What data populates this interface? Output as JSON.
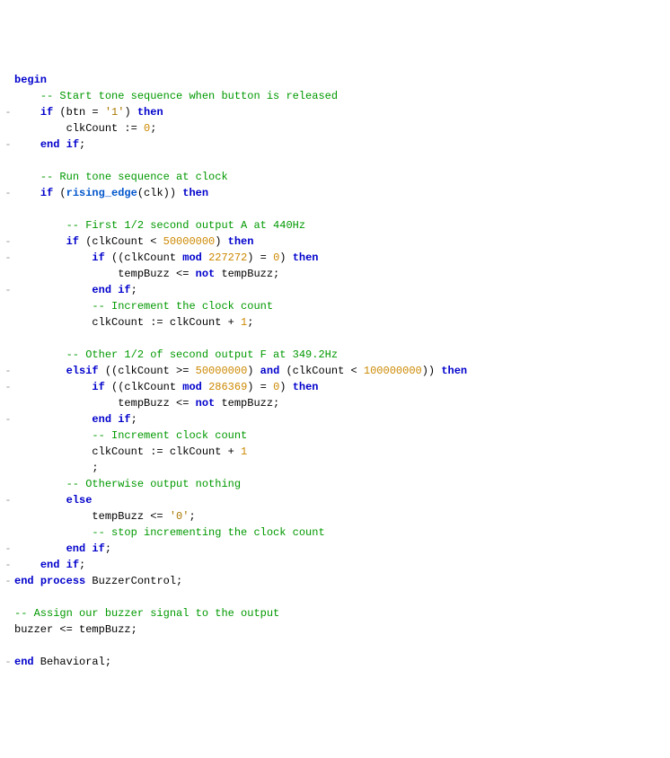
{
  "code": {
    "lines": [
      {
        "fold": " ",
        "segs": [
          {
            "cls": "kw",
            "t": "begin"
          }
        ]
      },
      {
        "fold": " ",
        "segs": [
          {
            "cls": "",
            "t": "    "
          },
          {
            "cls": "cmt",
            "t": "-- Start tone sequence when button is released"
          }
        ]
      },
      {
        "fold": "-",
        "segs": [
          {
            "cls": "",
            "t": "    "
          },
          {
            "cls": "kw",
            "t": "if"
          },
          {
            "cls": "",
            "t": " (btn = "
          },
          {
            "cls": "str",
            "t": "'1'"
          },
          {
            "cls": "",
            "t": ") "
          },
          {
            "cls": "kw",
            "t": "then"
          }
        ]
      },
      {
        "fold": " ",
        "segs": [
          {
            "cls": "",
            "t": "        clkCount := "
          },
          {
            "cls": "num",
            "t": "0"
          },
          {
            "cls": "",
            "t": ";"
          }
        ]
      },
      {
        "fold": "-",
        "segs": [
          {
            "cls": "",
            "t": "    "
          },
          {
            "cls": "kw",
            "t": "end"
          },
          {
            "cls": "",
            "t": " "
          },
          {
            "cls": "kw",
            "t": "if"
          },
          {
            "cls": "",
            "t": ";"
          }
        ]
      },
      {
        "fold": " ",
        "segs": [
          {
            "cls": "",
            "t": ""
          }
        ]
      },
      {
        "fold": " ",
        "segs": [
          {
            "cls": "",
            "t": "    "
          },
          {
            "cls": "cmt",
            "t": "-- Run tone sequence at clock"
          }
        ]
      },
      {
        "fold": "-",
        "segs": [
          {
            "cls": "",
            "t": "    "
          },
          {
            "cls": "kw",
            "t": "if"
          },
          {
            "cls": "",
            "t": " ("
          },
          {
            "cls": "func",
            "t": "rising_edge"
          },
          {
            "cls": "",
            "t": "(clk)) "
          },
          {
            "cls": "kw",
            "t": "then"
          }
        ]
      },
      {
        "fold": " ",
        "segs": [
          {
            "cls": "",
            "t": ""
          }
        ]
      },
      {
        "fold": " ",
        "segs": [
          {
            "cls": "",
            "t": "        "
          },
          {
            "cls": "cmt",
            "t": "-- First 1/2 second output A at 440Hz"
          }
        ]
      },
      {
        "fold": "-",
        "segs": [
          {
            "cls": "",
            "t": "        "
          },
          {
            "cls": "kw",
            "t": "if"
          },
          {
            "cls": "",
            "t": " (clkCount < "
          },
          {
            "cls": "num",
            "t": "50000000"
          },
          {
            "cls": "",
            "t": ") "
          },
          {
            "cls": "kw",
            "t": "then"
          }
        ]
      },
      {
        "fold": "-",
        "segs": [
          {
            "cls": "",
            "t": "            "
          },
          {
            "cls": "kw",
            "t": "if"
          },
          {
            "cls": "",
            "t": " ((clkCount "
          },
          {
            "cls": "kw",
            "t": "mod"
          },
          {
            "cls": "",
            "t": " "
          },
          {
            "cls": "num",
            "t": "227272"
          },
          {
            "cls": "",
            "t": ") = "
          },
          {
            "cls": "num",
            "t": "0"
          },
          {
            "cls": "",
            "t": ") "
          },
          {
            "cls": "kw",
            "t": "then"
          }
        ]
      },
      {
        "fold": " ",
        "segs": [
          {
            "cls": "",
            "t": "                tempBuzz <= "
          },
          {
            "cls": "kw",
            "t": "not"
          },
          {
            "cls": "",
            "t": " tempBuzz;"
          }
        ]
      },
      {
        "fold": "-",
        "segs": [
          {
            "cls": "",
            "t": "            "
          },
          {
            "cls": "kw",
            "t": "end"
          },
          {
            "cls": "",
            "t": " "
          },
          {
            "cls": "kw",
            "t": "if"
          },
          {
            "cls": "",
            "t": ";"
          }
        ]
      },
      {
        "fold": " ",
        "segs": [
          {
            "cls": "",
            "t": "            "
          },
          {
            "cls": "cmt",
            "t": "-- Increment the clock count"
          }
        ]
      },
      {
        "fold": " ",
        "segs": [
          {
            "cls": "",
            "t": "            clkCount := clkCount + "
          },
          {
            "cls": "num",
            "t": "1"
          },
          {
            "cls": "",
            "t": ";"
          }
        ]
      },
      {
        "fold": " ",
        "segs": [
          {
            "cls": "",
            "t": ""
          }
        ]
      },
      {
        "fold": " ",
        "segs": [
          {
            "cls": "",
            "t": "        "
          },
          {
            "cls": "cmt",
            "t": "-- Other 1/2 of second output F at 349.2Hz"
          }
        ]
      },
      {
        "fold": "-",
        "segs": [
          {
            "cls": "",
            "t": "        "
          },
          {
            "cls": "kw",
            "t": "elsif"
          },
          {
            "cls": "",
            "t": " ((clkCount >= "
          },
          {
            "cls": "num",
            "t": "50000000"
          },
          {
            "cls": "",
            "t": ") "
          },
          {
            "cls": "kw",
            "t": "and"
          },
          {
            "cls": "",
            "t": " (clkCount < "
          },
          {
            "cls": "num",
            "t": "100000000"
          },
          {
            "cls": "",
            "t": ")) "
          },
          {
            "cls": "kw",
            "t": "then"
          }
        ]
      },
      {
        "fold": "-",
        "segs": [
          {
            "cls": "",
            "t": "            "
          },
          {
            "cls": "kw",
            "t": "if"
          },
          {
            "cls": "",
            "t": " ((clkCount "
          },
          {
            "cls": "kw",
            "t": "mod"
          },
          {
            "cls": "",
            "t": " "
          },
          {
            "cls": "num",
            "t": "286369"
          },
          {
            "cls": "",
            "t": ") = "
          },
          {
            "cls": "num",
            "t": "0"
          },
          {
            "cls": "",
            "t": ") "
          },
          {
            "cls": "kw",
            "t": "then"
          }
        ]
      },
      {
        "fold": " ",
        "segs": [
          {
            "cls": "",
            "t": "                tempBuzz <= "
          },
          {
            "cls": "kw",
            "t": "not"
          },
          {
            "cls": "",
            "t": " tempBuzz;"
          }
        ]
      },
      {
        "fold": "-",
        "segs": [
          {
            "cls": "",
            "t": "            "
          },
          {
            "cls": "kw",
            "t": "end"
          },
          {
            "cls": "",
            "t": " "
          },
          {
            "cls": "kw",
            "t": "if"
          },
          {
            "cls": "",
            "t": ";"
          }
        ]
      },
      {
        "fold": " ",
        "segs": [
          {
            "cls": "",
            "t": "            "
          },
          {
            "cls": "cmt",
            "t": "-- Increment clock count"
          }
        ]
      },
      {
        "fold": " ",
        "segs": [
          {
            "cls": "",
            "t": "            clkCount := clkCount + "
          },
          {
            "cls": "num",
            "t": "1"
          }
        ]
      },
      {
        "fold": " ",
        "segs": [
          {
            "cls": "",
            "t": "            ;"
          }
        ]
      },
      {
        "fold": " ",
        "segs": [
          {
            "cls": "",
            "t": "        "
          },
          {
            "cls": "cmt",
            "t": "-- Otherwise output nothing"
          }
        ]
      },
      {
        "fold": "-",
        "segs": [
          {
            "cls": "",
            "t": "        "
          },
          {
            "cls": "kw",
            "t": "else"
          }
        ]
      },
      {
        "fold": " ",
        "segs": [
          {
            "cls": "",
            "t": "            tempBuzz <= "
          },
          {
            "cls": "str",
            "t": "'0'"
          },
          {
            "cls": "",
            "t": ";"
          }
        ]
      },
      {
        "fold": " ",
        "segs": [
          {
            "cls": "",
            "t": "            "
          },
          {
            "cls": "cmt",
            "t": "-- stop incrementing the clock count"
          }
        ]
      },
      {
        "fold": "-",
        "segs": [
          {
            "cls": "",
            "t": "        "
          },
          {
            "cls": "kw",
            "t": "end"
          },
          {
            "cls": "",
            "t": " "
          },
          {
            "cls": "kw",
            "t": "if"
          },
          {
            "cls": "",
            "t": ";"
          }
        ]
      },
      {
        "fold": "-",
        "segs": [
          {
            "cls": "",
            "t": "    "
          },
          {
            "cls": "kw",
            "t": "end"
          },
          {
            "cls": "",
            "t": " "
          },
          {
            "cls": "kw",
            "t": "if"
          },
          {
            "cls": "",
            "t": ";"
          }
        ]
      },
      {
        "fold": "-",
        "segs": [
          {
            "cls": "kw",
            "t": "end"
          },
          {
            "cls": "",
            "t": " "
          },
          {
            "cls": "kw",
            "t": "process"
          },
          {
            "cls": "",
            "t": " BuzzerControl;"
          }
        ]
      },
      {
        "fold": " ",
        "segs": [
          {
            "cls": "",
            "t": ""
          }
        ]
      },
      {
        "fold": " ",
        "segs": [
          {
            "cls": "cmt",
            "t": "-- Assign our buzzer signal to the output"
          }
        ]
      },
      {
        "fold": " ",
        "segs": [
          {
            "cls": "",
            "t": "buzzer <= tempBuzz;"
          }
        ]
      },
      {
        "fold": " ",
        "segs": [
          {
            "cls": "",
            "t": ""
          }
        ]
      },
      {
        "fold": "-",
        "segs": [
          {
            "cls": "kw",
            "t": "end"
          },
          {
            "cls": "",
            "t": " Behavioral;"
          }
        ]
      }
    ]
  }
}
